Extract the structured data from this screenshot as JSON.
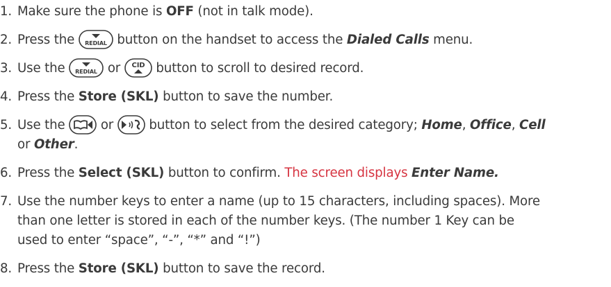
{
  "steps": [
    {
      "num": "1.",
      "a": "Make sure the phone is ",
      "b": "OFF",
      "c": " (not in talk mode)."
    },
    {
      "num": "2.",
      "a": "Press the ",
      "b": " button on the handset to access the ",
      "c": "Dialed Calls",
      "d": " menu."
    },
    {
      "num": "3.",
      "a": "Use the ",
      "b": " or ",
      "c": " button to scroll to desired record."
    },
    {
      "num": "4.",
      "a": "Press the ",
      "b": "Store (SKL)",
      "c": " button to save the number."
    },
    {
      "num": "5.",
      "a": "Use the ",
      "b": " or ",
      "c": " button to select from the desired category; ",
      "d": "Home",
      "e": ", ",
      "f": "Office",
      "g": ", ",
      "h": "Cell",
      "i": "or ",
      "j": "Other",
      "k": "."
    },
    {
      "num": "6.",
      "a": "Press the ",
      "b": "Select (SKL)",
      "c": " button to confirm. ",
      "d": "The screen displays ",
      "e": "Enter Name."
    },
    {
      "num": "7.",
      "a": "Use the number keys to enter a name (up to 15 characters, including spaces). More",
      "b": "than one letter is stored in each of the number keys. (The number 1 Key can be",
      "c": "used to enter “space”, “-”, “*” and “!”)"
    },
    {
      "num": "8.",
      "a": "Press the ",
      "b": "Store (SKL)",
      "c": " button to save the record."
    }
  ],
  "keys": {
    "redial": "REDIAL",
    "cid": "CID"
  },
  "icons": [
    "redial-down-key-icon",
    "cid-up-key-icon",
    "phonebook-left-key-icon",
    "memo-right-key-icon"
  ],
  "colors": {
    "text": "#3a3a3a",
    "highlight": "#d63340"
  }
}
